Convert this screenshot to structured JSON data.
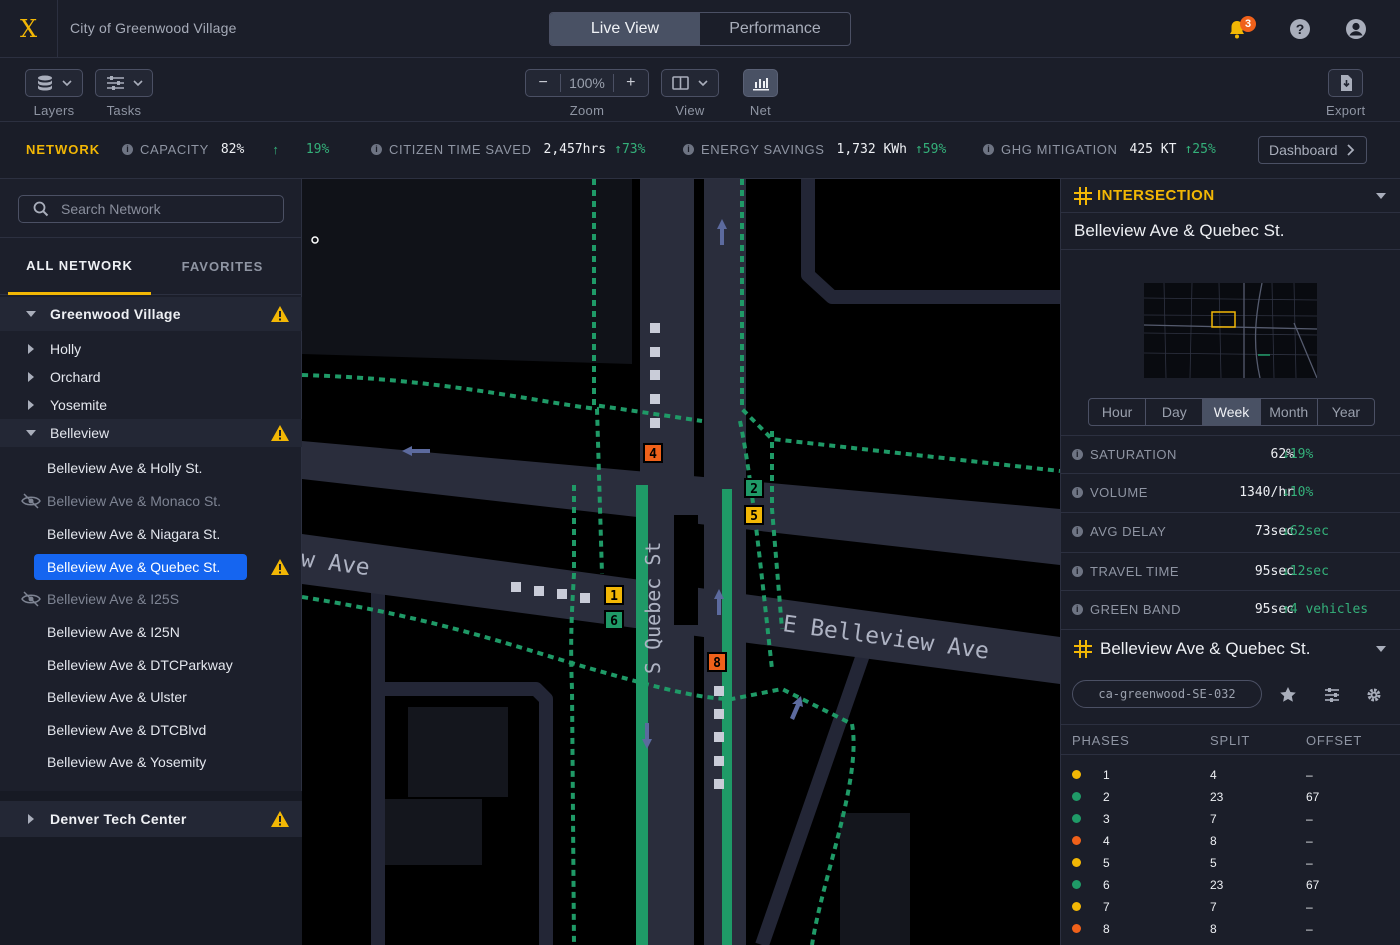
{
  "app": {
    "logo": "X",
    "title": "City of Greenwood Village",
    "view_tabs": [
      "Live View",
      "Performance"
    ],
    "active_view": "Live View",
    "notification_count": "3"
  },
  "toolbar": {
    "layers_label": "Layers",
    "tasks_label": "Tasks",
    "zoom_label": "Zoom",
    "zoom_value": "100%",
    "zoom_minus": "−",
    "zoom_plus": "+",
    "view_label": "View",
    "net_label": "Net",
    "export_label": "Export"
  },
  "kpis": {
    "network_label": "NETWORK",
    "capacity": {
      "label": "CAPACITY",
      "value": "82%",
      "arrow": "↑",
      "delta": "19%"
    },
    "citizen_time": {
      "label": "CITIZEN TIME SAVED",
      "value": "2,457hrs",
      "delta": "↑73%"
    },
    "energy": {
      "label": "ENERGY SAVINGS",
      "value": "1,732 KWh",
      "delta": "↑59%"
    },
    "ghg": {
      "label": "GHG MITIGATION",
      "value": "425 KT",
      "delta": "↑25%"
    },
    "dashboard_button": "Dashboard"
  },
  "sidebar": {
    "search_placeholder": "Search Network",
    "tabs": [
      "ALL NETWORK",
      "FAVORITES"
    ],
    "group": "Greenwood Village",
    "subgroups": [
      "Holly",
      "Orchard",
      "Yosemite",
      "Belleview"
    ],
    "intersections": [
      {
        "label": "Belleview Ave & Holly St.",
        "state": "normal"
      },
      {
        "label": "Belleview Ave & Monaco St.",
        "state": "hidden"
      },
      {
        "label": "Belleview Ave & Niagara St.",
        "state": "normal"
      },
      {
        "label": "Belleview Ave & Quebec St.",
        "state": "selected"
      },
      {
        "label": "Belleview Ave & I25S",
        "state": "hidden"
      },
      {
        "label": "Belleview Ave & I25N",
        "state": "normal"
      },
      {
        "label": "Belleview Ave & DTCParkway",
        "state": "normal"
      },
      {
        "label": "Belleview Ave & Ulster",
        "state": "normal"
      },
      {
        "label": "Belleview Ave & DTCBlvd",
        "state": "normal"
      },
      {
        "label": "Belleview Ave & Yosemity",
        "state": "normal"
      }
    ],
    "second_group": "Denver Tech Center"
  },
  "map": {
    "street_ew": "E Belleview Ave",
    "street_ew_west": "w Ave",
    "street_ns": "S Quebec St",
    "phase_markers": [
      "4",
      "2",
      "5",
      "1",
      "6",
      "8"
    ]
  },
  "intersection_panel": {
    "section_label": "INTERSECTION",
    "name": "Belleview Ave & Quebec St.",
    "periods": [
      "Hour",
      "Day",
      "Week",
      "Month",
      "Year"
    ],
    "active_period": "Week",
    "metrics": [
      {
        "label": "SATURATION",
        "value": "62%",
        "delta": "↓19%"
      },
      {
        "label": "VOLUME",
        "value": "1340/hr",
        "delta": "↓10%"
      },
      {
        "label": "AVG DELAY",
        "value": "73sec",
        "delta": "↓62sec"
      },
      {
        "label": "TRAVEL TIME",
        "value": "95sec",
        "delta": "↓12sec"
      },
      {
        "label": "GREEN BAND",
        "value": "95sec",
        "delta": "↑4 vehicles"
      }
    ],
    "controller_name": "Belleview Ave & Quebec St.",
    "device_id": "ca-greenwood-SE-032",
    "phase_headers": [
      "PHASES",
      "SPLIT",
      "OFFSET"
    ],
    "phases": [
      {
        "phase": "1",
        "split": "4",
        "offset": "–",
        "color": "#f2b705"
      },
      {
        "phase": "2",
        "split": "23",
        "offset": "67",
        "color": "#1f9a67"
      },
      {
        "phase": "3",
        "split": "7",
        "offset": "–",
        "color": "#1f9a67"
      },
      {
        "phase": "4",
        "split": "8",
        "offset": "–",
        "color": "#f0611a"
      },
      {
        "phase": "5",
        "split": "5",
        "offset": "–",
        "color": "#f2b705"
      },
      {
        "phase": "6",
        "split": "23",
        "offset": "67",
        "color": "#1f9a67"
      },
      {
        "phase": "7",
        "split": "7",
        "offset": "–",
        "color": "#f2b705"
      },
      {
        "phase": "8",
        "split": "8",
        "offset": "–",
        "color": "#f0611a"
      }
    ]
  },
  "colors": {
    "accent": "#f2b705",
    "positive": "#34b07a",
    "selected": "#1565f0",
    "alert": "#f0611a"
  }
}
